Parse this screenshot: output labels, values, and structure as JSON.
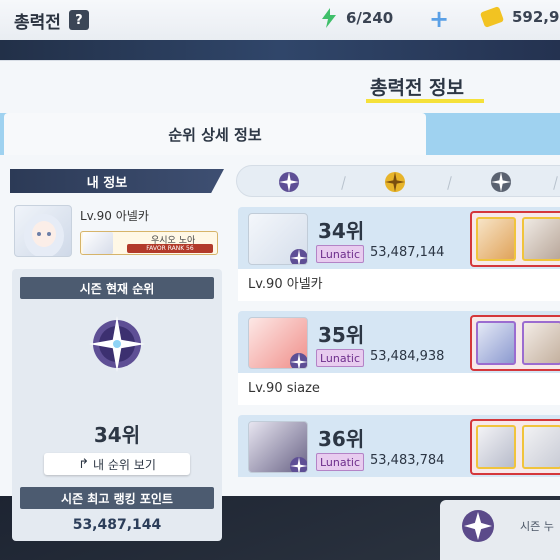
{
  "header": {
    "title": "총력전",
    "help_label": "?",
    "ap": "6/240",
    "credits": "592,9"
  },
  "panel": {
    "title": "총력전 정보",
    "tab_label": "순위 상세 정보"
  },
  "my_info": {
    "header": "내 정보",
    "level": "Lv.90 아넬카",
    "student_name": "우시오 노아",
    "favor_rank": "FAVOR RANK 56"
  },
  "season": {
    "current_rank_label": "시즌 현재 순위",
    "rank": "34위",
    "view_rank_button": "내 순위 보기",
    "best_points_label": "시즌 최고 랭킹 포인트",
    "best_points": "53,487,144"
  },
  "ranks": [
    {
      "rank": "34위",
      "difficulty": "Lunatic",
      "score": "53,487,144",
      "name": "Lv.90 아넬카"
    },
    {
      "rank": "35위",
      "difficulty": "Lunatic",
      "score": "53,484,938",
      "name": "Lv.90 siaze"
    },
    {
      "rank": "36위",
      "difficulty": "Lunatic",
      "score": "53,483,784",
      "name": ""
    }
  ],
  "background_hint": {
    "text": "시즌 누"
  },
  "colors": {
    "accent_yellow": "#f5e13a",
    "lunatic_purple": "#6d2e8c",
    "tab_blue": "#9fd2f0",
    "team_red": "#d4373b"
  }
}
